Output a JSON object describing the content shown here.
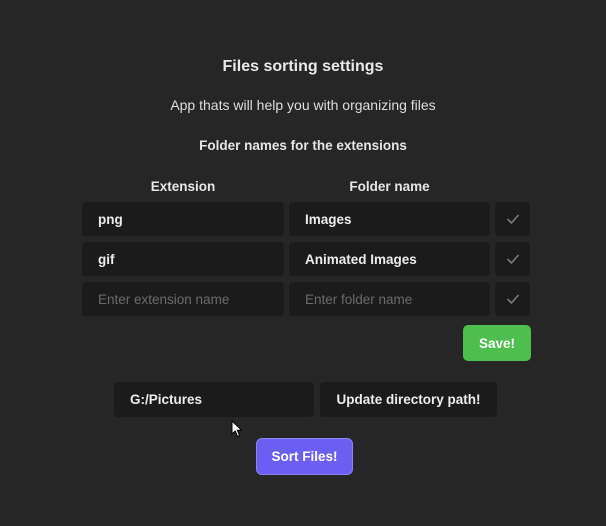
{
  "header": {
    "title": "Files sorting settings",
    "subtitle": "App thats will help you with organizing files"
  },
  "mapping": {
    "heading": "Folder names for the extensions",
    "columns": {
      "extension": "Extension",
      "folder": "Folder name"
    },
    "rows": [
      {
        "extension": "png",
        "folder": "Images"
      },
      {
        "extension": "gif",
        "folder": "Animated Images"
      }
    ],
    "new_row": {
      "extension_placeholder": "Enter extension name",
      "folder_placeholder": "Enter folder name"
    },
    "save_label": "Save!"
  },
  "directory": {
    "path": "G:/Pictures",
    "update_label": "Update directory path!"
  },
  "actions": {
    "sort_label": "Sort Files!"
  },
  "icons": {
    "row_action": "check-icon",
    "pointer": "mouse-cursor-icon"
  },
  "colors": {
    "background": "#262626",
    "field": "#1b1b1b",
    "save_button": "#4ebf4e",
    "sort_button": "#6a5ff0"
  }
}
